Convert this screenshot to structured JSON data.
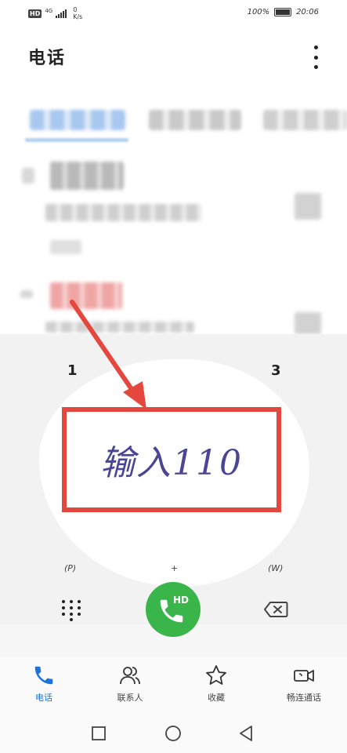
{
  "status_bar": {
    "hd": "HD",
    "net": "4G",
    "speed_value": "0",
    "speed_unit": "K/s",
    "battery": "100%",
    "time": "20:06"
  },
  "header": {
    "title": "电话"
  },
  "annotation": {
    "text": "输入110"
  },
  "dialpad": {
    "key1": "1",
    "key3": "3",
    "hint_p": "(P)",
    "hint_plus": "+",
    "hint_w": "(W)",
    "call_badge": "HD"
  },
  "bottom_nav": [
    {
      "label": "电话",
      "icon": "phone-icon",
      "active": true
    },
    {
      "label": "联系人",
      "icon": "contacts-icon",
      "active": false
    },
    {
      "label": "收藏",
      "icon": "star-icon",
      "active": false
    },
    {
      "label": "畅连通话",
      "icon": "video-call-icon",
      "active": false
    }
  ],
  "colors": {
    "accent": "#1c73dc",
    "call": "#3ab54a",
    "annotation": "#e4473d",
    "annotation_text": "#4a4594"
  }
}
